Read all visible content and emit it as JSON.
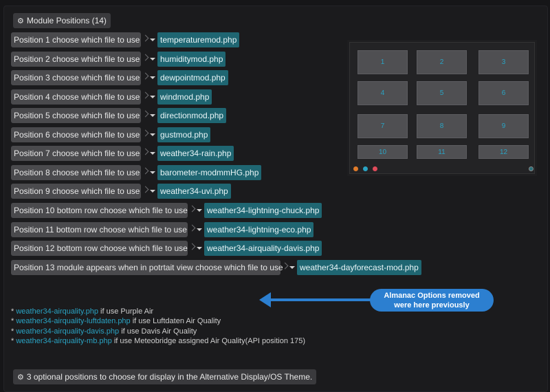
{
  "header": {
    "icon": "gear-icon",
    "title": "Module Positions (14)"
  },
  "rows": [
    {
      "label": "Position 1 choose which file to use",
      "value": "temperaturemod.php"
    },
    {
      "label": "Position 2 choose which file to use",
      "value": "humiditymod.php"
    },
    {
      "label": "Position 3 choose which file to use",
      "value": "dewpointmod.php"
    },
    {
      "label": "Position 4 choose which file to use",
      "value": "windmod.php"
    },
    {
      "label": "Position 5 choose which file to use",
      "value": "directionmod.php"
    },
    {
      "label": "Position 6 choose which file to use",
      "value": "gustmod.php"
    },
    {
      "label": "Position 7 choose which file to use",
      "value": "weather34-rain.php"
    },
    {
      "label": "Position 8 choose which file to use",
      "value": "barometer-modmmHG.php"
    },
    {
      "label": "Position 9 choose which file to use",
      "value": "weather34-uvi.php"
    },
    {
      "label": "Position 10 bottom row choose which file to use",
      "value": "weather34-lightning-chuck.php"
    },
    {
      "label": "Position 11 bottom row choose which file to use",
      "value": "weather34-lightning-eco.php"
    },
    {
      "label": "Position 12 bottom row choose which file to use",
      "value": "weather34-airquality-davis.php"
    },
    {
      "label": "Position 13 module appears when in potrtait view choose which file to use",
      "value": "weather34-dayforecast-mod.php"
    }
  ],
  "preview": {
    "cells": [
      "1",
      "2",
      "3",
      "4",
      "5",
      "6",
      "7",
      "8",
      "9",
      "10",
      "11",
      "12"
    ],
    "dots": [
      "#e07b2a",
      "#2aa3c3",
      "#e04b5a"
    ]
  },
  "callout": {
    "line1": "Almanac Options removed",
    "line2": "were here previously"
  },
  "notes": [
    {
      "prefix": "* ",
      "link": "weather34-airquality.php",
      "text": " if use Purple Air"
    },
    {
      "prefix": "* ",
      "link": "weather34-airquality-luftdaten.php",
      "text": " if use Luftdaten Air Quality"
    },
    {
      "prefix": "* ",
      "link": "weather34-airquality-davis.php",
      "text": " if use Davis Air Quality"
    },
    {
      "prefix": "* ",
      "link": "weather34-airquality-mb.php",
      "text": " if use Meteobridge assigned Air Quality(API position 175)"
    }
  ],
  "footer": {
    "icon": "gear-icon",
    "title": "3 optional positions to choose for display in the Alternative Display/OS Theme."
  },
  "colors": {
    "accent": "#1f6672",
    "link": "#2aa3c3",
    "callout": "#2c7fd0"
  }
}
